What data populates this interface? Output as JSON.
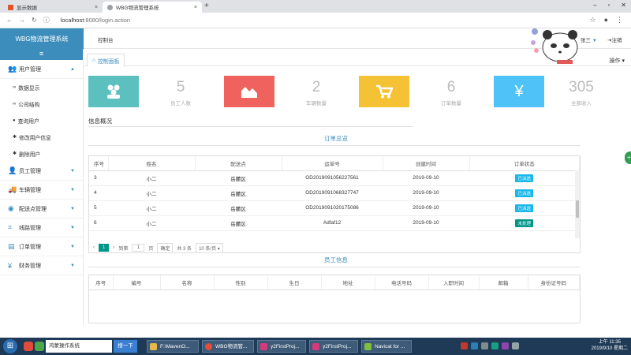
{
  "browser": {
    "tabs": [
      {
        "title": "显示数据",
        "active": false
      },
      {
        "title": "WBG物流管理系统",
        "active": true
      }
    ],
    "new_tab": "+",
    "url_host": "localhost",
    "url_rest": ":8080/login.action"
  },
  "header": {
    "brand": "WBG物流管理系统",
    "nav_console": "控制台",
    "user_name": "张三",
    "logout": "注销"
  },
  "sidebar": {
    "toggle": "≡",
    "groups": [
      {
        "label": "用户管理",
        "expanded": true,
        "icon": "users-icon",
        "items": [
          "数据显示",
          "公司结构",
          "查询用户",
          "修改用户信息",
          "删除用户"
        ]
      },
      {
        "label": "员工管理",
        "icon": "staff-icon"
      },
      {
        "label": "车辆管理",
        "icon": "truck-icon"
      },
      {
        "label": "配送点管理",
        "icon": "location-icon"
      },
      {
        "label": "线路管理",
        "icon": "route-icon"
      },
      {
        "label": "订单管理",
        "icon": "order-icon"
      },
      {
        "label": "财务管理",
        "icon": "finance-icon"
      }
    ]
  },
  "main": {
    "tab_label": "控制面板",
    "operations": "操作",
    "stats": [
      {
        "value": "5",
        "label": "员工人数",
        "color": "#5bc0be",
        "icon": "people-icon"
      },
      {
        "value": "2",
        "label": "车辆数量",
        "color": "#f0625d",
        "icon": "chart-icon"
      },
      {
        "value": "6",
        "label": "订单数量",
        "color": "#f5c235",
        "icon": "cart-icon"
      },
      {
        "value": "305",
        "label": "全部收入",
        "color": "#4fc3f7",
        "icon": "yen-icon"
      }
    ],
    "info_title": "信息概况",
    "orders": {
      "title": "订单总览",
      "columns": [
        "序号",
        "姓名",
        "配送点",
        "运单号",
        "创建时间",
        "订单状态"
      ],
      "rows": [
        {
          "no": "3",
          "name": "小二",
          "point": "岳麓区",
          "waybill": "OD2019091056227561",
          "created": "2019-09-10",
          "status": "已派送",
          "status_color": "#1ab7ea"
        },
        {
          "no": "4",
          "name": "小二",
          "point": "岳麓区",
          "waybill": "OD2019091068327747",
          "created": "2019-09-10",
          "status": "已派送",
          "status_color": "#1ab7ea"
        },
        {
          "no": "5",
          "name": "小二",
          "point": "岳麓区",
          "waybill": "OD2019091020175086",
          "created": "2019-09-10",
          "status": "已派送",
          "status_color": "#1ab7ea"
        },
        {
          "no": "6",
          "name": "小二",
          "point": "岳麓区",
          "waybill": "Adfaf12",
          "created": "2019-09-10",
          "status": "未处理",
          "status_color": "#009688"
        }
      ],
      "pager": {
        "prev": "‹",
        "current": "1",
        "next": "›",
        "goto_label": "到第",
        "goto_value": "1",
        "page_unit": "页",
        "confirm": "确定",
        "total": "共 3 条",
        "page_size": "10 条/页"
      }
    },
    "staff": {
      "title": "员工信息",
      "columns": [
        "序号",
        "编号",
        "名称",
        "性别",
        "生日",
        "地址",
        "电话号码",
        "入职时间",
        "邮箱",
        "身份证号码"
      ]
    }
  },
  "taskbar": {
    "search_text": "鸿蒙操作系统",
    "search_button": "搜一下",
    "tasks": [
      {
        "label": "F:\\MavenO...",
        "color": "#e8b84a"
      },
      {
        "label": "WBG物流管...",
        "color": "#e44d3a"
      },
      {
        "label": "y2FirstProj...",
        "color": "#d63a7a"
      },
      {
        "label": "y2FirstProj...",
        "color": "#d63a7a"
      },
      {
        "label": "Navicat for ...",
        "color": "#7fbf3f"
      }
    ],
    "time": "上午 11:35",
    "date": "2019/9/10 星期二"
  }
}
